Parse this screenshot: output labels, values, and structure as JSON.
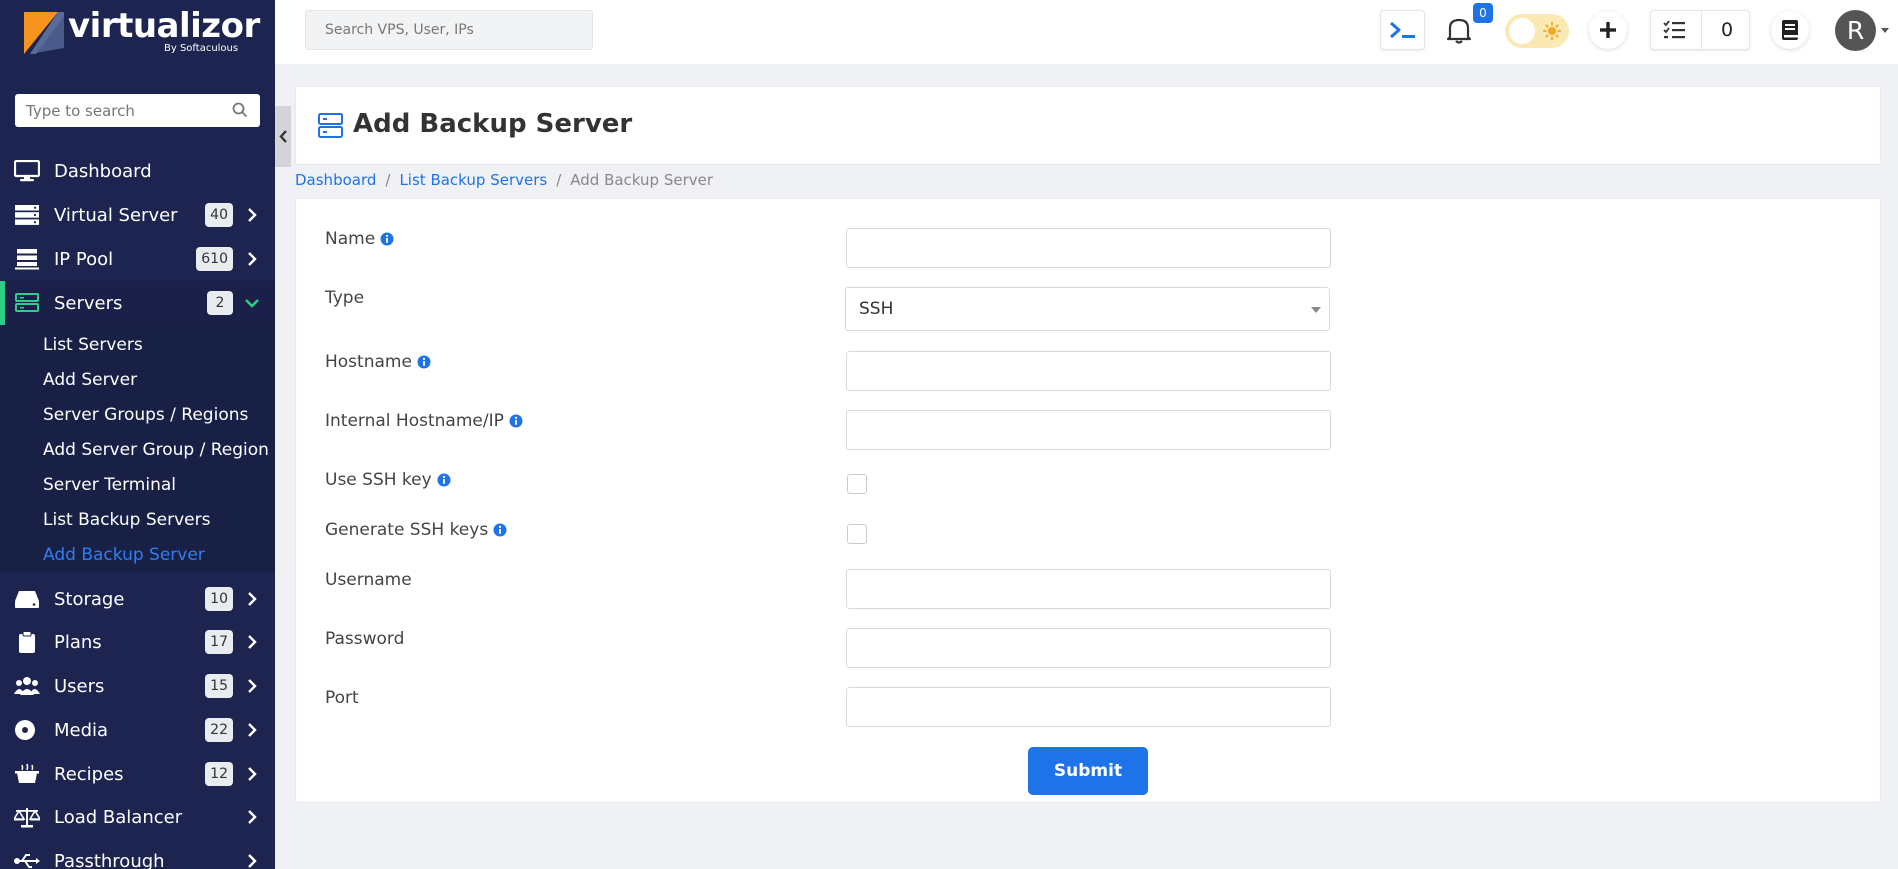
{
  "brand": {
    "name": "virtualizor",
    "sub": "By Softaculous"
  },
  "sidebar": {
    "search_placeholder": "Type to search",
    "items": [
      {
        "label": "Dashboard",
        "badge": ""
      },
      {
        "label": "Virtual Server",
        "badge": "40"
      },
      {
        "label": "IP Pool",
        "badge": "610"
      },
      {
        "label": "Servers",
        "badge": "2"
      },
      {
        "label": "Storage",
        "badge": "10"
      },
      {
        "label": "Plans",
        "badge": "17"
      },
      {
        "label": "Users",
        "badge": "15"
      },
      {
        "label": "Media",
        "badge": "22"
      },
      {
        "label": "Recipes",
        "badge": "12"
      },
      {
        "label": "Load Balancer",
        "badge": ""
      },
      {
        "label": "Passthrough",
        "badge": ""
      }
    ],
    "submenu": [
      "List Servers",
      "Add Server",
      "Server Groups / Regions",
      "Add Server Group / Region",
      "Server Terminal",
      "List Backup Servers",
      "Add Backup Server"
    ]
  },
  "topbar": {
    "search_placeholder": "Search VPS, User, IPs",
    "notifications": "0",
    "tasks": "0",
    "avatar": "R"
  },
  "page": {
    "title": "Add Backup Server",
    "breadcrumb": [
      "Dashboard",
      "List Backup Servers",
      "Add Backup Server"
    ]
  },
  "form": {
    "name_label": "Name",
    "type_label": "Type",
    "type_value": "SSH",
    "hostname_label": "Hostname",
    "internal_label": "Internal Hostname/IP",
    "use_ssh_label": "Use SSH key",
    "gen_ssh_label": "Generate SSH keys",
    "username_label": "Username",
    "password_label": "Password",
    "port_label": "Port",
    "submit": "Submit"
  },
  "colors": {
    "sidebar_bg": "#1d2450",
    "accent": "#1f73e8",
    "active_marker": "#2dce89",
    "logo_orange": "#f7941d"
  }
}
